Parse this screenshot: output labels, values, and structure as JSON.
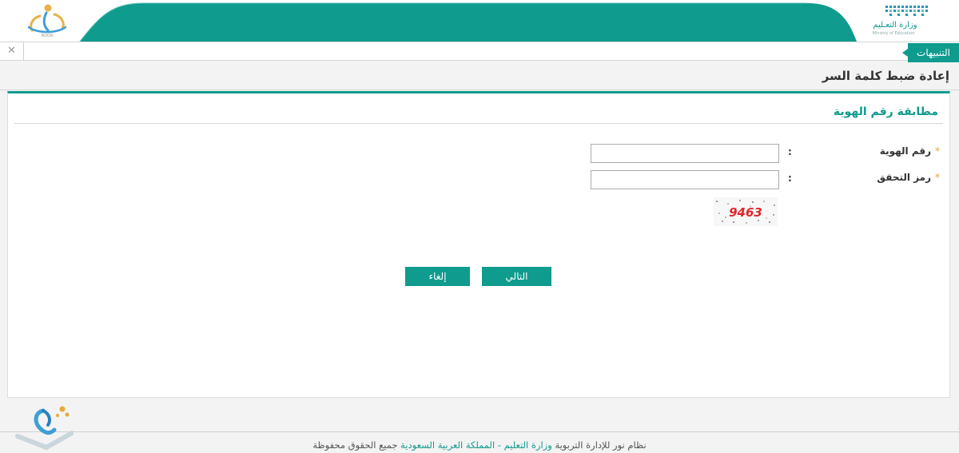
{
  "header": {
    "ministry_name": "وزارة التعـليم",
    "ministry_name_en": "Ministry of Education",
    "left_logo_caption": "NOOR"
  },
  "notifications": {
    "tab_label": "التنبيهات",
    "close_glyph": "✕"
  },
  "page": {
    "title": "إعادة ضبط كلمة السر"
  },
  "form": {
    "section_title": "مطابقة رقم الهوية",
    "fields": [
      {
        "label": "رقم الهوية",
        "value": "",
        "placeholder": ""
      },
      {
        "label": "رمز التحقق",
        "value": "",
        "placeholder": ""
      }
    ],
    "required_mark": "*",
    "colon": ":",
    "captcha_code": "9463",
    "buttons": {
      "next": "التالي",
      "cancel": "إلغاء"
    }
  },
  "footer": {
    "text_part1": "نظام نور للإدارة التربوية",
    "text_highlight": "وزارة التعليم - المملكة العربية السعودية",
    "text_part2": "جميع الحقوق محفوظة"
  },
  "colors": {
    "accent": "#0f9b8e",
    "required": "#e8a227",
    "captcha_text": "#e0262b"
  }
}
